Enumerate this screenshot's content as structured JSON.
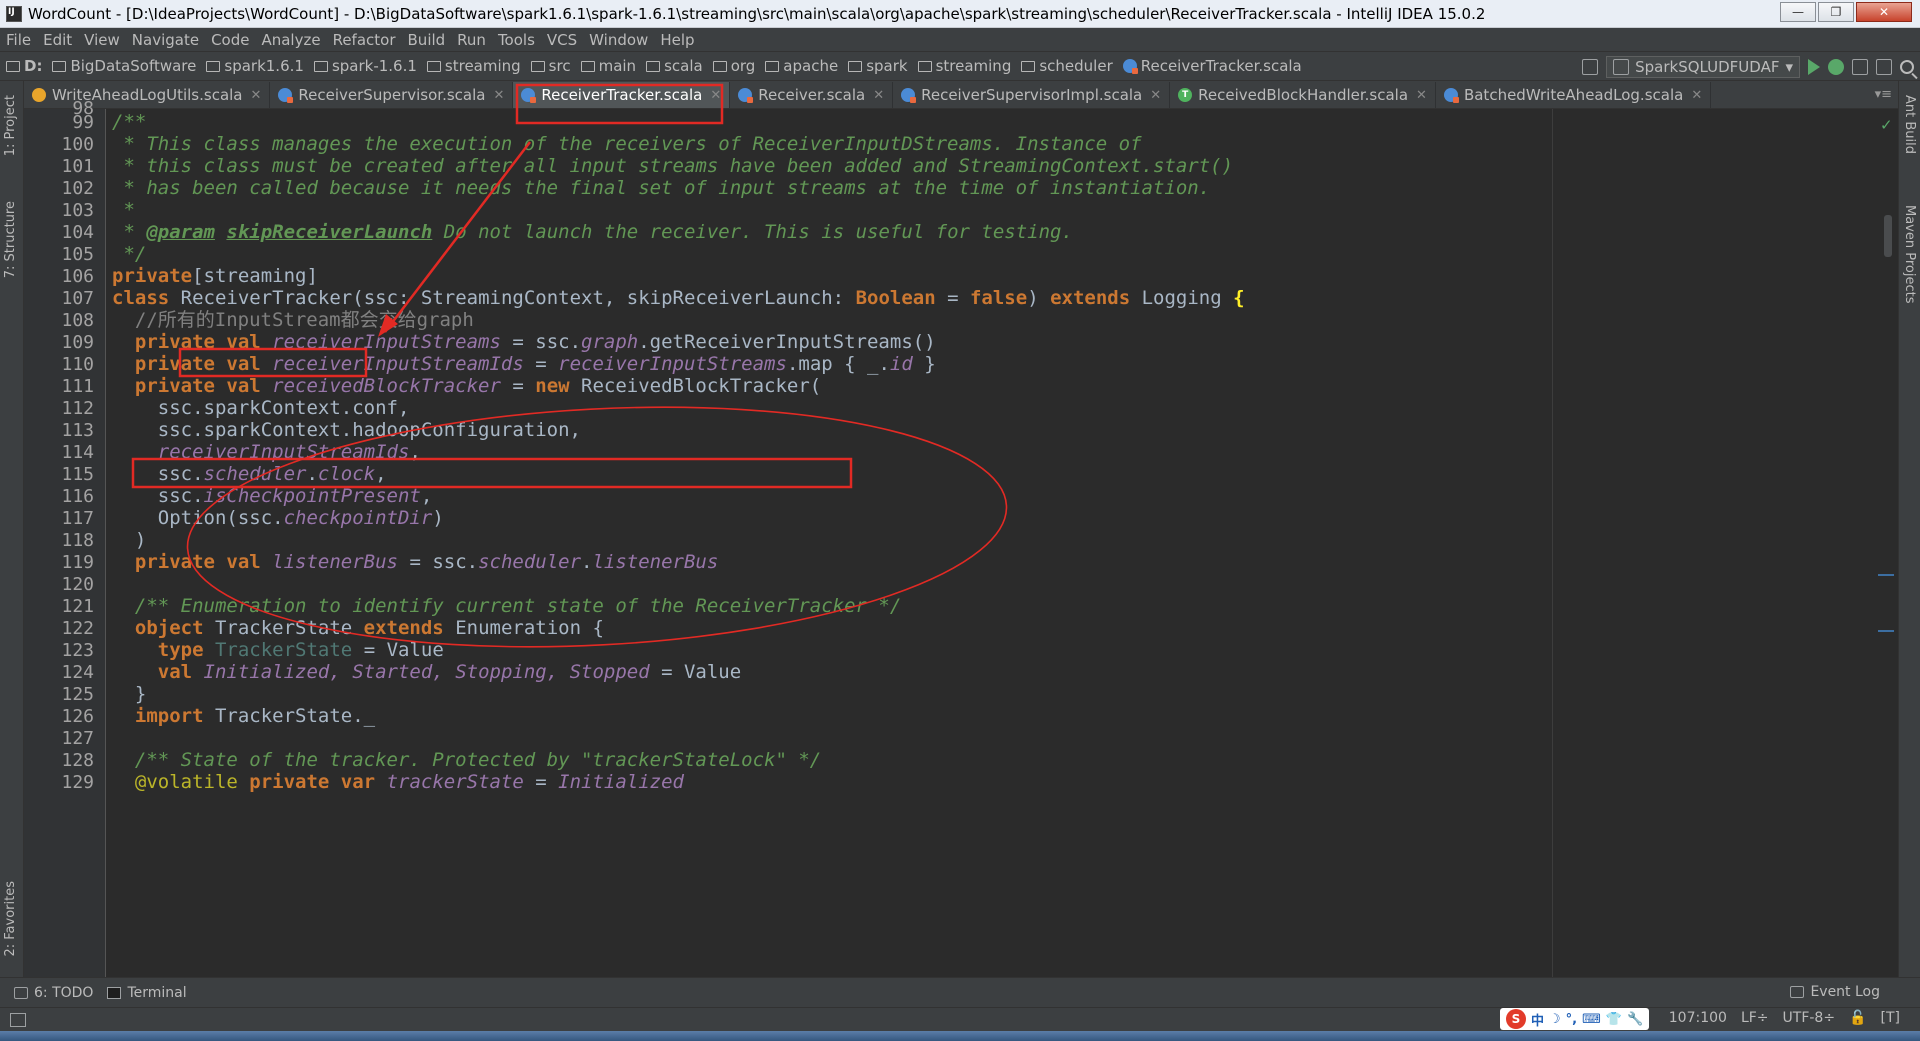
{
  "window": {
    "title": "WordCount - [D:\\IdeaProjects\\WordCount] - D:\\BigDataSoftware\\spark1.6.1\\spark-1.6.1\\streaming\\src\\main\\scala\\org\\apache\\spark\\streaming\\scheduler\\ReceiverTracker.scala - IntelliJ IDEA 15.0.2",
    "controls": [
      "—",
      "❐",
      "✕"
    ]
  },
  "menu": [
    "File",
    "Edit",
    "View",
    "Navigate",
    "Code",
    "Analyze",
    "Refactor",
    "Build",
    "Run",
    "Tools",
    "VCS",
    "Window",
    "Help"
  ],
  "breadcrumbs": [
    "D:",
    "BigDataSoftware",
    "spark1.6.1",
    "spark-1.6.1",
    "streaming",
    "src",
    "main",
    "scala",
    "org",
    "apache",
    "spark",
    "streaming",
    "scheduler",
    "ReceiverTracker.scala"
  ],
  "run_config": "SparkSQLUDFUDAF",
  "tabs": [
    {
      "label": "WriteAheadLogUtils.scala",
      "icon": "object-icon",
      "active": false
    },
    {
      "label": "ReceiverSupervisor.scala",
      "icon": "scala-class-icon",
      "active": false
    },
    {
      "label": "ReceiverTracker.scala",
      "icon": "scala-class-icon",
      "active": true
    },
    {
      "label": "Receiver.scala",
      "icon": "scala-class-icon",
      "active": false
    },
    {
      "label": "ReceiverSupervisorImpl.scala",
      "icon": "scala-class-icon",
      "active": false
    },
    {
      "label": "ReceivedBlockHandler.scala",
      "icon": "trait-icon",
      "active": false
    },
    {
      "label": "BatchedWriteAheadLog.scala",
      "icon": "scala-class-icon",
      "active": false
    }
  ],
  "tool_windows": {
    "left": [
      "1: Project",
      "7: Structure",
      "2: Favorites"
    ],
    "right": [
      "Ant Build",
      "Maven Projects"
    ],
    "bottom": [
      "6: TODO",
      "Terminal"
    ],
    "event_log": "Event Log"
  },
  "status": {
    "position": "107:100",
    "line_sep": "LF÷",
    "encoding": "UTF-8÷"
  },
  "ime": [
    "S",
    "中",
    "☽",
    "°,",
    "⌨",
    "👕",
    "🔧"
  ],
  "editor": {
    "first_partial_line": "98",
    "lines": [
      {
        "n": "99"
      },
      {
        "n": "100"
      },
      {
        "n": "101"
      },
      {
        "n": "102"
      },
      {
        "n": "103"
      },
      {
        "n": "104"
      },
      {
        "n": "105"
      },
      {
        "n": "106"
      },
      {
        "n": "107"
      },
      {
        "n": "108"
      },
      {
        "n": "109"
      },
      {
        "n": "110"
      },
      {
        "n": "111"
      },
      {
        "n": "112"
      },
      {
        "n": "113"
      },
      {
        "n": "114"
      },
      {
        "n": "115"
      },
      {
        "n": "116"
      },
      {
        "n": "117"
      },
      {
        "n": "118"
      },
      {
        "n": "119"
      },
      {
        "n": "120"
      },
      {
        "n": "121"
      },
      {
        "n": "122"
      },
      {
        "n": "123"
      },
      {
        "n": "124"
      },
      {
        "n": "125"
      },
      {
        "n": "126"
      },
      {
        "n": "127"
      },
      {
        "n": "128"
      },
      {
        "n": "129"
      }
    ],
    "code": {
      "l99": "/**",
      "l100": " * This class manages the execution of the receivers of ReceiverInputDStreams. Instance of",
      "l101": " * this class must be created after all input streams have been added and StreamingContext.start()",
      "l102": " * has been called because it needs the final set of input streams at the time of instantiation.",
      "l103": " *",
      "l104_a": " * ",
      "l104_tag": "@param",
      "l104_sp": " ",
      "l104_param": "skipReceiverLaunch",
      "l104_b": " Do not launch the receiver. This is useful for testing.",
      "l105": " */",
      "l106_kw": "private",
      "l106_b": "[streaming]",
      "l107_kw": "class",
      "l107_name": "ReceiverTracker",
      "l107_b": "(ssc: StreamingContext, skipReceiverLaunch: ",
      "l107_bool": "Boolean",
      "l107_eq": " = ",
      "l107_false": "false",
      "l107_c": ") ",
      "l107_ext": "extends",
      "l107_d": " Logging ",
      "l107_brace": "{",
      "l108": "  //所有的InputStream都会交给graph",
      "l109_kw": "  private val ",
      "l109_f": "receiverInputStreams",
      "l109_b": " = ssc.",
      "l109_g": "graph",
      "l109_c": ".getReceiverInputStreams()",
      "l110_kw": "  private val ",
      "l110_f": "receiverInputStreamIds",
      "l110_b": " = ",
      "l110_g": "receiverInputStreams",
      "l110_c": ".map { _.",
      "l110_id": "id",
      "l110_d": " }",
      "l111_kw": "  private val ",
      "l111_f": "receivedBlockTracker",
      "l111_b": " = ",
      "l111_new": "new",
      "l111_c": " ReceivedBlockTracker(",
      "l112": "    ssc.sparkContext.conf,",
      "l113": "    ssc.sparkContext.hadoopConfiguration,",
      "l114_f": "    receiverInputStreamIds",
      "l114_b": ",",
      "l115_a": "    ssc.",
      "l115_f": "scheduler",
      "l115_b": ".",
      "l115_g": "clock",
      "l115_c": ",",
      "l116_a": "    ssc.",
      "l116_f": "isCheckpointPresent",
      "l116_b": ",",
      "l117_a": "    Option(ssc.",
      "l117_f": "checkpointDir",
      "l117_b": ")",
      "l118": "  )",
      "l119_kw": "  private val ",
      "l119_f": "listenerBus",
      "l119_b": " = ssc.",
      "l119_g": "scheduler",
      "l119_c": ".",
      "l119_h": "listenerBus",
      "l121": "  /** Enumeration to identify current state of the ReceiverTracker */",
      "l122_kw": "  object",
      "l122_b": " TrackerState ",
      "l122_ext": "extends",
      "l122_c": " Enumeration {",
      "l123_kw": "    type",
      "l123_sp": " ",
      "l123_t": "TrackerState",
      "l123_b": " = Value",
      "l124_kw": "    val",
      "l124_sp": " ",
      "l124_f": "Initialized, Started, Stopping, Stopped",
      "l124_b": " = Value",
      "l125": "  }",
      "l126_kw": "  import",
      "l126_b": " TrackerState._",
      "l128": "  /** State of the tracker. Protected by \"trackerStateLock\" */",
      "l129_an": "  @volatile",
      "l129_kw": " private var ",
      "l129_f": "trackerState",
      "l129_b": " = ",
      "l129_g": "Initialized"
    }
  },
  "colors": {
    "editor_bg": "#2b2b2b",
    "keyword": "#cc7832",
    "doc_comment": "#629755",
    "field": "#9876aa",
    "annotation_red": "#e22a24"
  }
}
